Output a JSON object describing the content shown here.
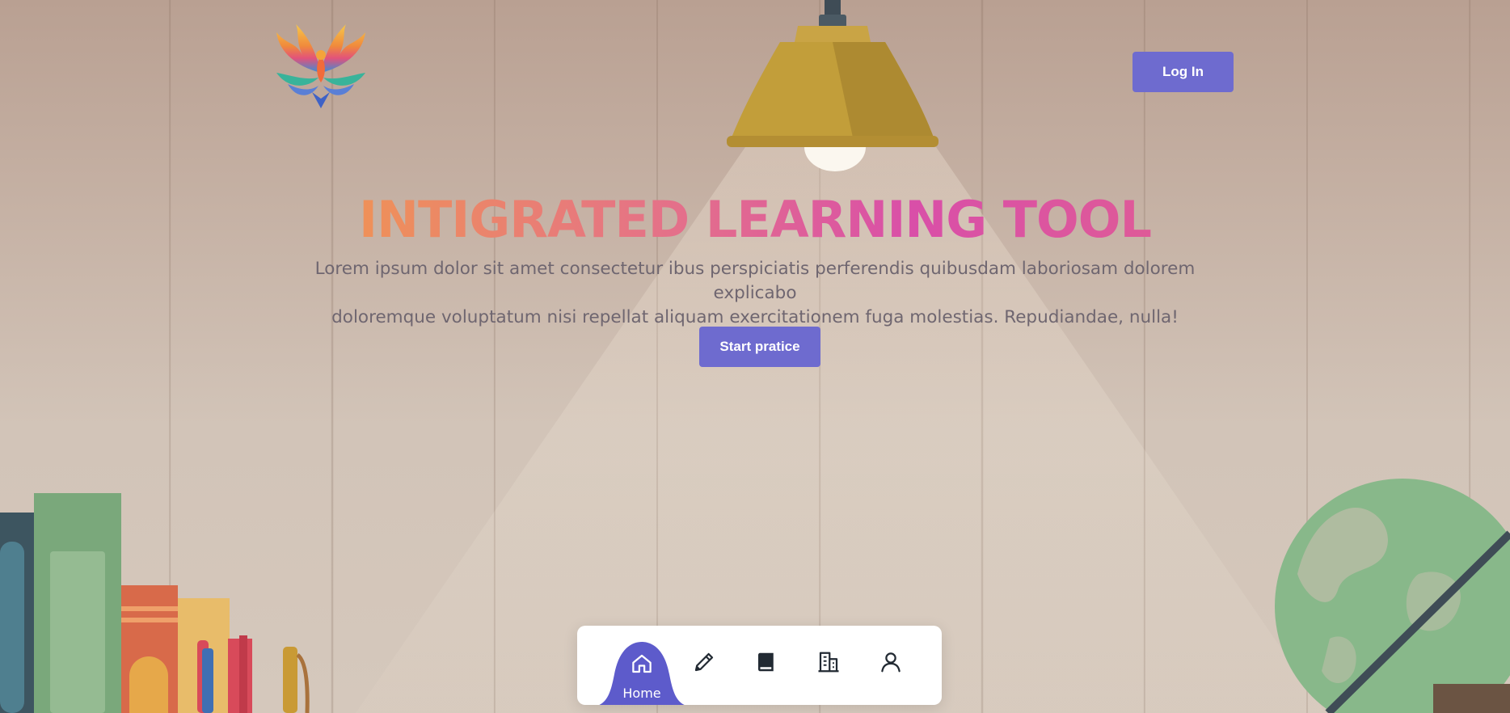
{
  "header": {
    "logo": "phoenix-logo",
    "login_label": "Log In"
  },
  "hero": {
    "title": "INTIGRATED LEARNING TOOL",
    "description_line1": "Lorem ipsum dolor sit amet consectetur ibus perspiciatis perferendis quibusdam laboriosam dolorem explicabo",
    "description_line2": "doloremque voluptatum nisi repellat aliquam exercitationem fuga molestias. Repudiandae, nulla!",
    "start_label": "Start pratice"
  },
  "nav": {
    "items": [
      {
        "icon": "home-icon",
        "label": "Home",
        "active": true
      },
      {
        "icon": "pencil-icon",
        "label": "",
        "active": false
      },
      {
        "icon": "book-icon",
        "label": "",
        "active": false
      },
      {
        "icon": "building-icon",
        "label": "",
        "active": false
      },
      {
        "icon": "user-icon",
        "label": "",
        "active": false
      }
    ]
  },
  "colors": {
    "accent": "#6e6bcf",
    "title_gradient_start": "#ef9158",
    "title_gradient_end": "#d94fa8",
    "text_muted": "#6f6670",
    "background": "#c6b2a5"
  }
}
